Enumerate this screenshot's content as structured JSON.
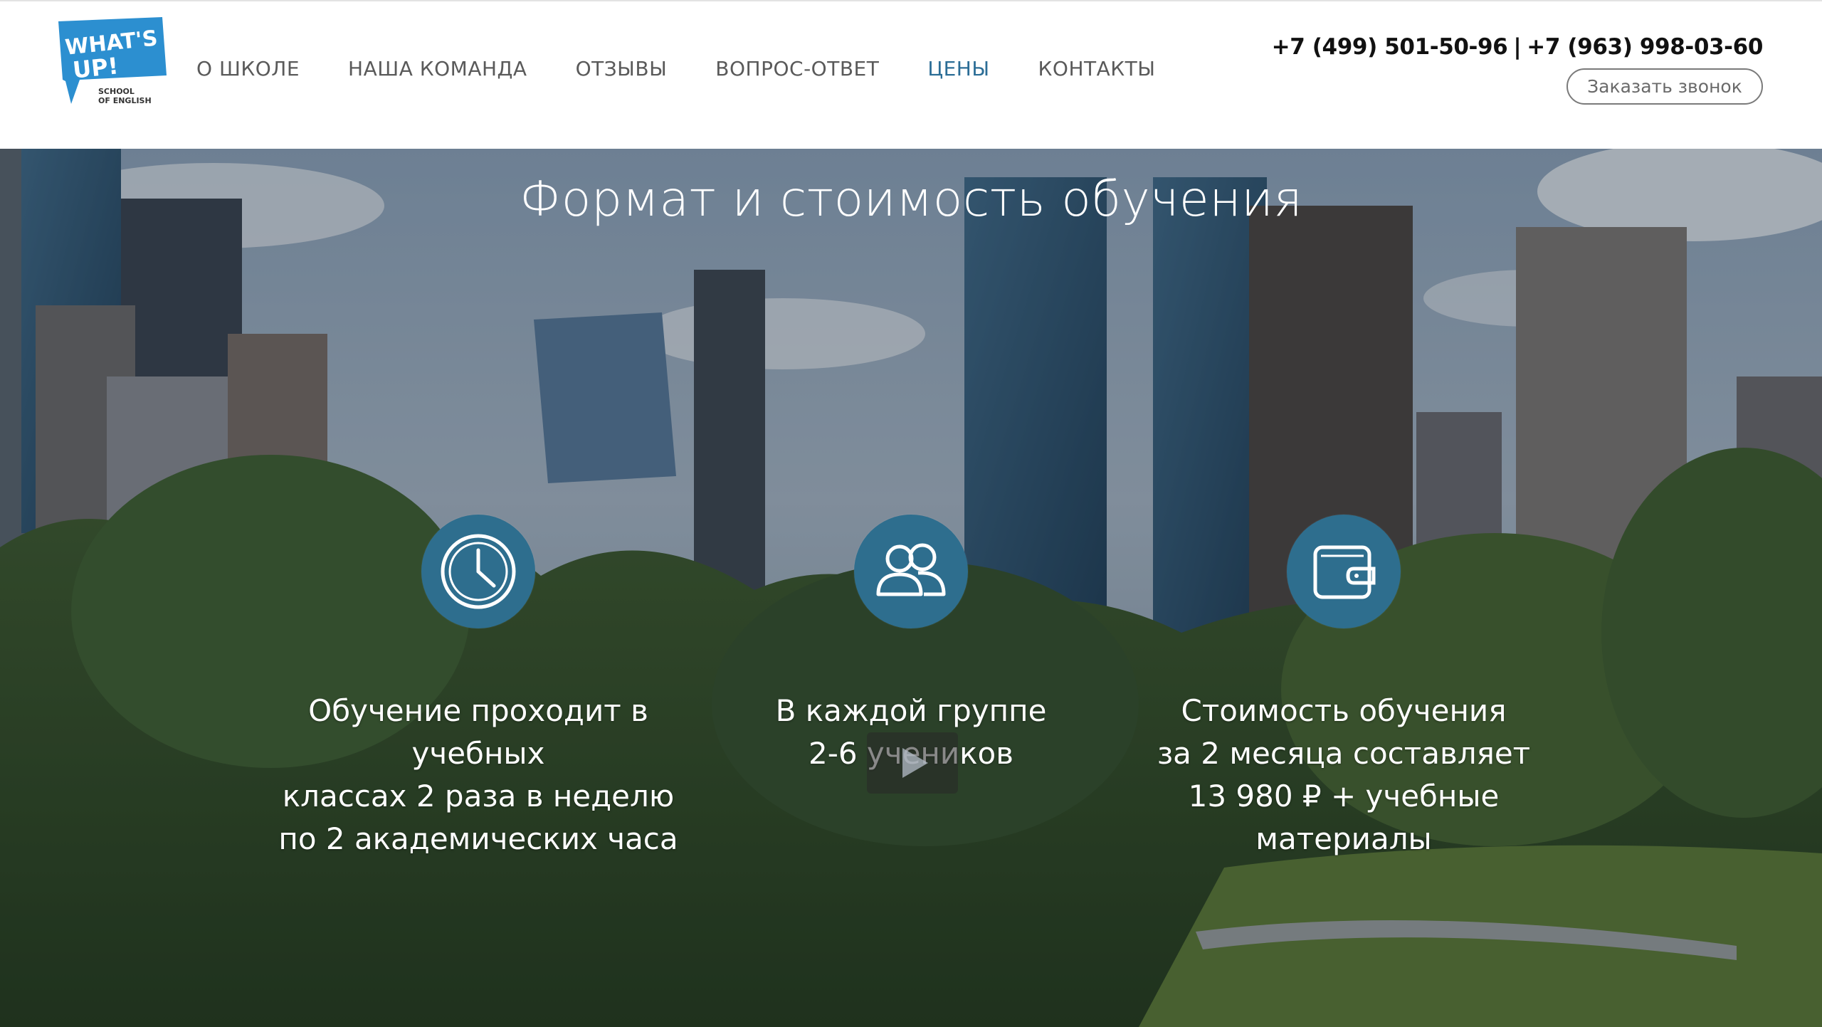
{
  "header": {
    "logo": {
      "text_line1": "WHAT'S",
      "text_line2": "UP!",
      "sub_line1": "SCHOOL",
      "sub_line2": "OF ENGLISH",
      "color": "#2c8fd0"
    },
    "nav": [
      {
        "label": "О ШКОЛЕ"
      },
      {
        "label": "НАША КОМАНДА"
      },
      {
        "label": "ОТЗЫВЫ"
      },
      {
        "label": "ВОПРОС-ОТВЕТ"
      },
      {
        "label": "ЦЕНЫ",
        "active": true
      },
      {
        "label": "КОНТАКТЫ"
      }
    ],
    "phone1": "+7 (499) 501-50-96",
    "phone_separator": "|",
    "phone2": "+7 (963) 998-03-60",
    "callback_label": "Заказать звонок"
  },
  "hero": {
    "title": "Формат и стоимость обучения",
    "features": [
      {
        "icon": "clock-icon",
        "lines": [
          "Обучение проходит в",
          "учебных",
          "классах 2 раза в неделю",
          "по 2 академических часа"
        ]
      },
      {
        "icon": "group-icon",
        "lines": [
          "В каждой группе",
          "2-6 учеников"
        ]
      },
      {
        "icon": "wallet-icon",
        "lines": [
          "Стоимость обучения",
          "за 2 месяца составляет",
          "13 980 ₽ + учебные",
          "материалы"
        ]
      }
    ]
  },
  "colors": {
    "accent": "#2b6d96",
    "icon_circle": "#2e6e8e",
    "nav_text": "#5a5a5a"
  }
}
